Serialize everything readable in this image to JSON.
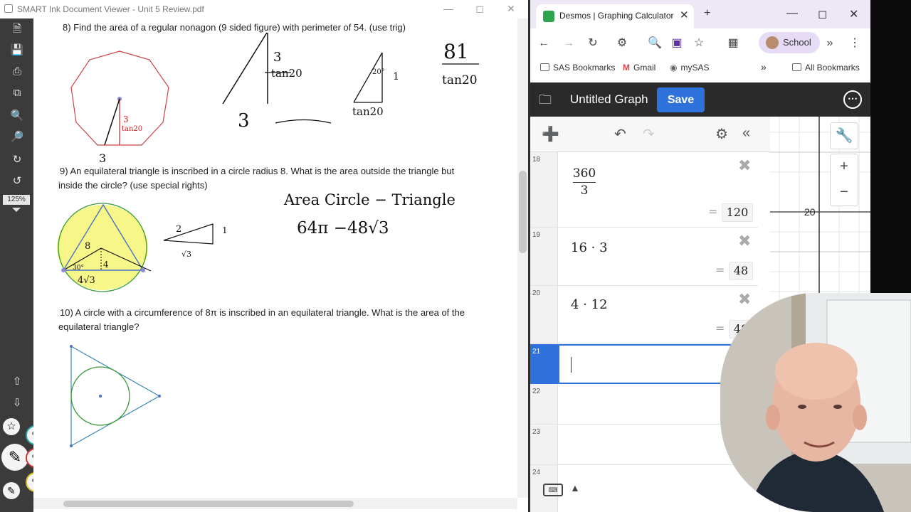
{
  "smart": {
    "title": "SMART Ink Document Viewer - Unit 5 Review.pdf",
    "zoom": "125%",
    "questions": {
      "q8": "8) Find the area of a regular nonagon (9 sided figure) with perimeter of 54. (use trig)",
      "q9a": "9) An equilateral triangle is inscribed in a circle radius 8.  What is the area outside the triangle but",
      "q9b": "inside the circle? (use special rights)",
      "q10a": "10) A circle with a circumference of 8π is inscribed in an equilateral triangle. What is the area of the",
      "q10b": "equilateral triangle?"
    },
    "handwriting": {
      "h1": "3",
      "h2": "tan20",
      "h3": "3",
      "h4": "20°",
      "h5": "1",
      "h6": "tan20",
      "h7": "81",
      "h8": "tan20",
      "h9": "3",
      "h10": "3",
      "h11": "tan20",
      "h12": "Area Circle − Triangle",
      "h13": "64π  −48√3",
      "h14": "2",
      "h15": "1",
      "h16": "√3",
      "h17": "8",
      "h18": "4",
      "h19": "4√3",
      "h20": "30°"
    }
  },
  "browser": {
    "tab_title": "Desmos | Graphing Calculator",
    "profile": "School",
    "bookmarks": [
      "SAS Bookmarks",
      "Gmail",
      "mySAS"
    ],
    "all_bookmarks": "All Bookmarks"
  },
  "desmos": {
    "graph_title": "Untitled Graph",
    "save": "Save",
    "tick_label": "20",
    "expressions": [
      {
        "num": "18",
        "num_top": "360",
        "den": "3",
        "result": "120"
      },
      {
        "num": "19",
        "expr": "16 · 3",
        "result": "48"
      },
      {
        "num": "20",
        "expr": "4 · 12",
        "result": "48"
      },
      {
        "num": "21"
      },
      {
        "num": "22"
      },
      {
        "num": "23"
      },
      {
        "num": "24"
      }
    ]
  },
  "icons": {
    "close": "close-icon",
    "minimize": "minimize-icon",
    "maximize": "maximize-icon",
    "back": "back-arrow-icon",
    "forward": "forward-arrow-icon",
    "reload": "reload-icon",
    "settings": "gear-icon",
    "undo": "undo-icon",
    "redo": "redo-icon",
    "add": "plus-icon",
    "wrench": "wrench-icon",
    "zoom_in": "zoom-in-icon",
    "zoom_out": "zoom-out-icon"
  }
}
